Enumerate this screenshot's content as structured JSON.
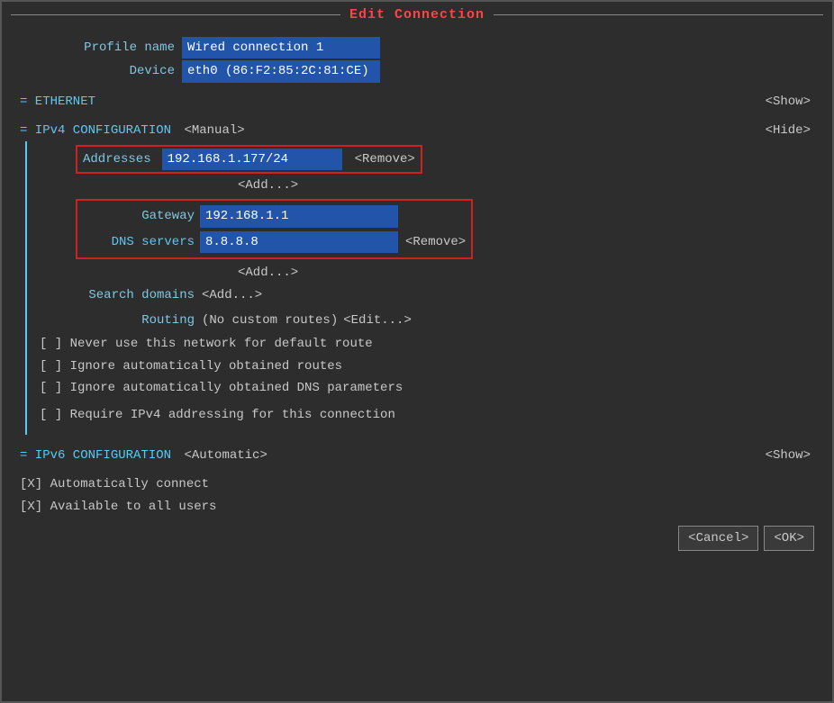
{
  "title": "Edit Connection",
  "profile": {
    "label": "Profile name",
    "value": "Wired connection 1"
  },
  "device": {
    "label": "Device",
    "value": "eth0 (86:F2:85:2C:81:CE)"
  },
  "ethernet_section": {
    "label": "= ETHERNET",
    "show": "<Show>"
  },
  "ipv4_section": {
    "label": "= IPv4 CONFIGURATION",
    "mode": "<Manual>",
    "hide": "<Hide>",
    "addresses_label": "Addresses",
    "addresses_value": "192.168.1.177/24",
    "addresses_remove": "<Remove>",
    "addresses_add": "<Add...>",
    "gateway_label": "Gateway",
    "gateway_value": "192.168.1.1",
    "dns_label": "DNS servers",
    "dns_value": "8.8.8.8",
    "dns_remove": "<Remove>",
    "dns_add": "<Add...>",
    "search_label": "Search domains",
    "search_add": "<Add...>",
    "routing_label": "Routing",
    "routing_value": "(No custom routes)",
    "routing_edit": "<Edit...>",
    "checkbox1": "[ ] Never use this network for default route",
    "checkbox2": "[ ] Ignore automatically obtained routes",
    "checkbox3": "[ ] Ignore automatically obtained DNS parameters",
    "checkbox4": "[ ] Require IPv4 addressing for this connection"
  },
  "ipv6_section": {
    "label": "= IPv6 CONFIGURATION",
    "mode": "<Automatic>",
    "show": "<Show>"
  },
  "auto_connect": "[X] Automatically connect",
  "available_users": "[X] Available to all users",
  "cancel_btn": "<Cancel>",
  "ok_btn": "<OK>"
}
